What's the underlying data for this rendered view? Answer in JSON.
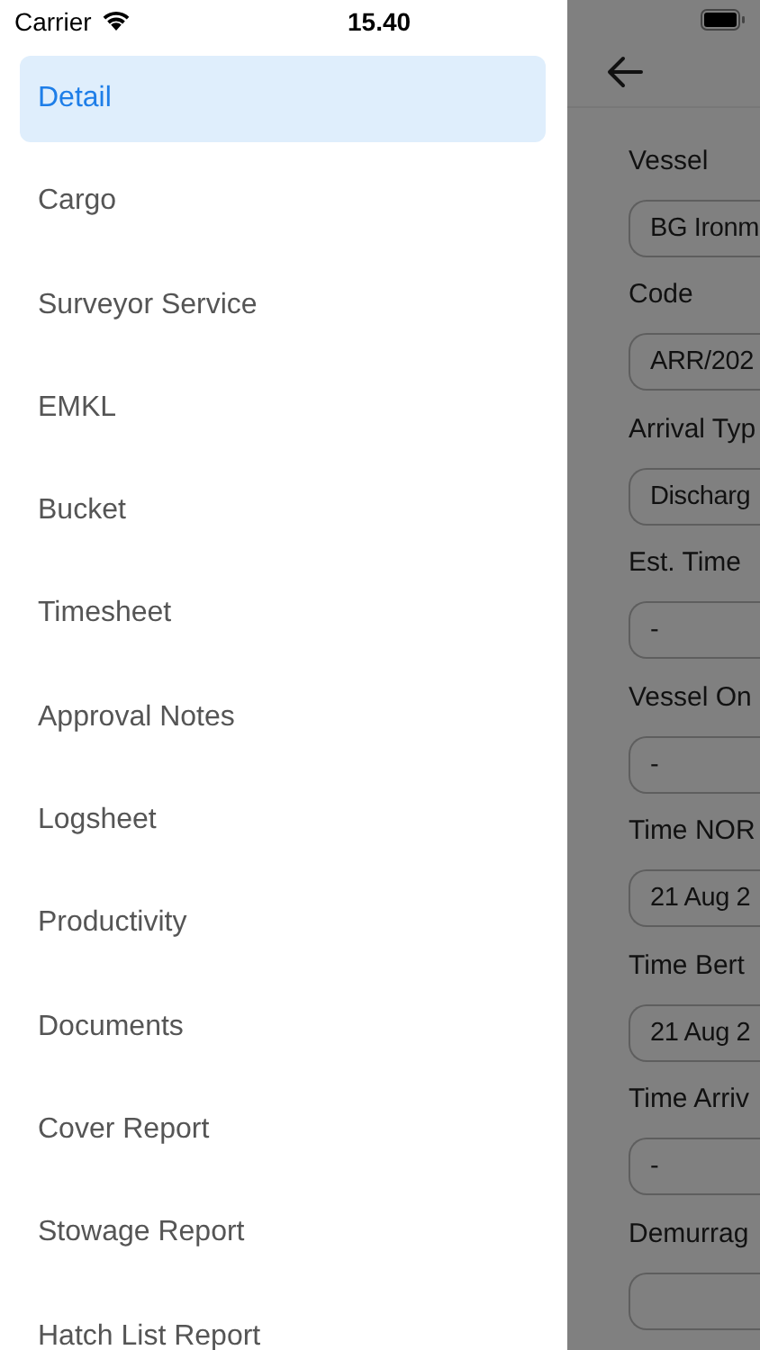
{
  "status_bar": {
    "carrier": "Carrier",
    "time": "15.40"
  },
  "menu": [
    {
      "label": "Detail",
      "selected": true
    },
    {
      "label": "Cargo",
      "selected": false
    },
    {
      "label": "Surveyor Service",
      "selected": false
    },
    {
      "label": "EMKL",
      "selected": false
    },
    {
      "label": "Bucket",
      "selected": false
    },
    {
      "label": "Timesheet",
      "selected": false
    },
    {
      "label": "Approval Notes",
      "selected": false
    },
    {
      "label": "Logsheet",
      "selected": false
    },
    {
      "label": "Productivity",
      "selected": false
    },
    {
      "label": "Documents",
      "selected": false
    },
    {
      "label": "Cover Report",
      "selected": false
    },
    {
      "label": "Stowage Report",
      "selected": false
    },
    {
      "label": "Hatch List Report",
      "selected": false
    }
  ],
  "detail": {
    "fields": [
      {
        "label": "Vessel",
        "value": "BG Ironm"
      },
      {
        "label": "Code",
        "value": "ARR/202"
      },
      {
        "label": "Arrival Typ",
        "value": "Discharg"
      },
      {
        "label": "Est. Time",
        "value": "-"
      },
      {
        "label": "Vessel On",
        "value": "-"
      },
      {
        "label": "Time NOR",
        "value": "21 Aug 2"
      },
      {
        "label": "Time Bert",
        "value": "21 Aug 2"
      },
      {
        "label": "Time Arriv",
        "value": "-"
      },
      {
        "label": "Demurrag"
      }
    ]
  }
}
